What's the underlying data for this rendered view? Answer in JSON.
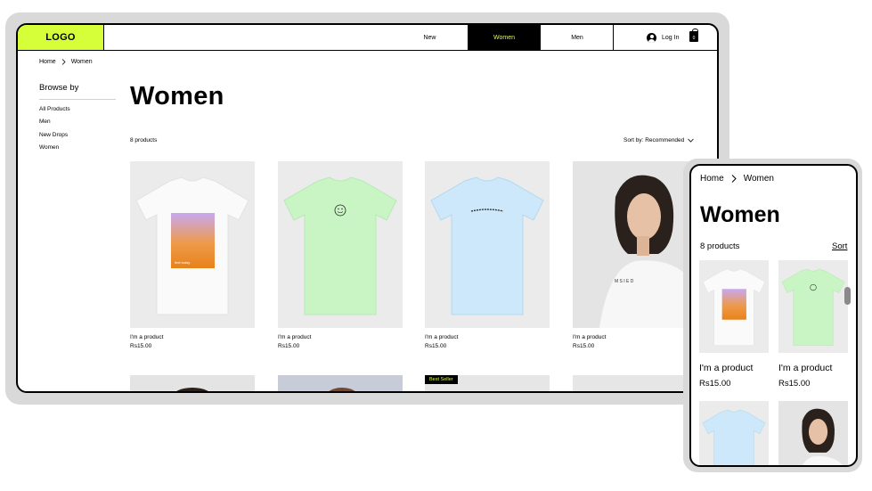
{
  "header": {
    "logo": "LOGO",
    "nav": [
      "New",
      "Women",
      "Men"
    ],
    "login": "Log In",
    "cart_count": "0"
  },
  "breadcrumb": {
    "home": "Home",
    "current": "Women"
  },
  "sidebar": {
    "title": "Browse by",
    "links": [
      "All Products",
      "Men",
      "New Drops",
      "Women"
    ]
  },
  "main": {
    "title": "Women",
    "count": "8 products",
    "sort": "Sort by: Recommended"
  },
  "products": [
    {
      "name": "I'm a product",
      "price": "Rs15.00"
    },
    {
      "name": "I'm a product",
      "price": "Rs15.00"
    },
    {
      "name": "I'm a product",
      "price": "Rs15.00"
    },
    {
      "name": "I'm a product",
      "price": "Rs15.00"
    }
  ],
  "badge": "Best Seller",
  "mobile": {
    "crumb_home": "Home",
    "crumb_current": "Women",
    "title": "Women",
    "count": "8 products",
    "sort": "Sort",
    "products": [
      {
        "name": "I'm a product",
        "price": "Rs15.00"
      },
      {
        "name": "I'm a product",
        "price": "Rs15.00"
      }
    ]
  },
  "colors": {
    "accent": "#d6ff3a",
    "frame": "#d9d9d9",
    "card_bg": "#ebebeb"
  }
}
